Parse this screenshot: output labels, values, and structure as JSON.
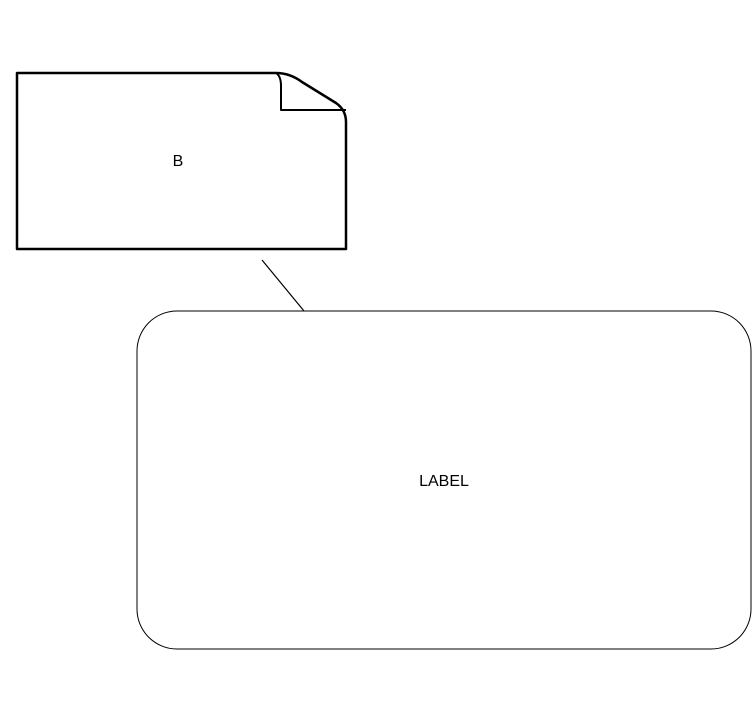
{
  "diagram": {
    "note_node": {
      "label": "B"
    },
    "rounded_node": {
      "label": "LABEL"
    },
    "stroke_color": "#000000",
    "fill_color": "#ffffff"
  }
}
